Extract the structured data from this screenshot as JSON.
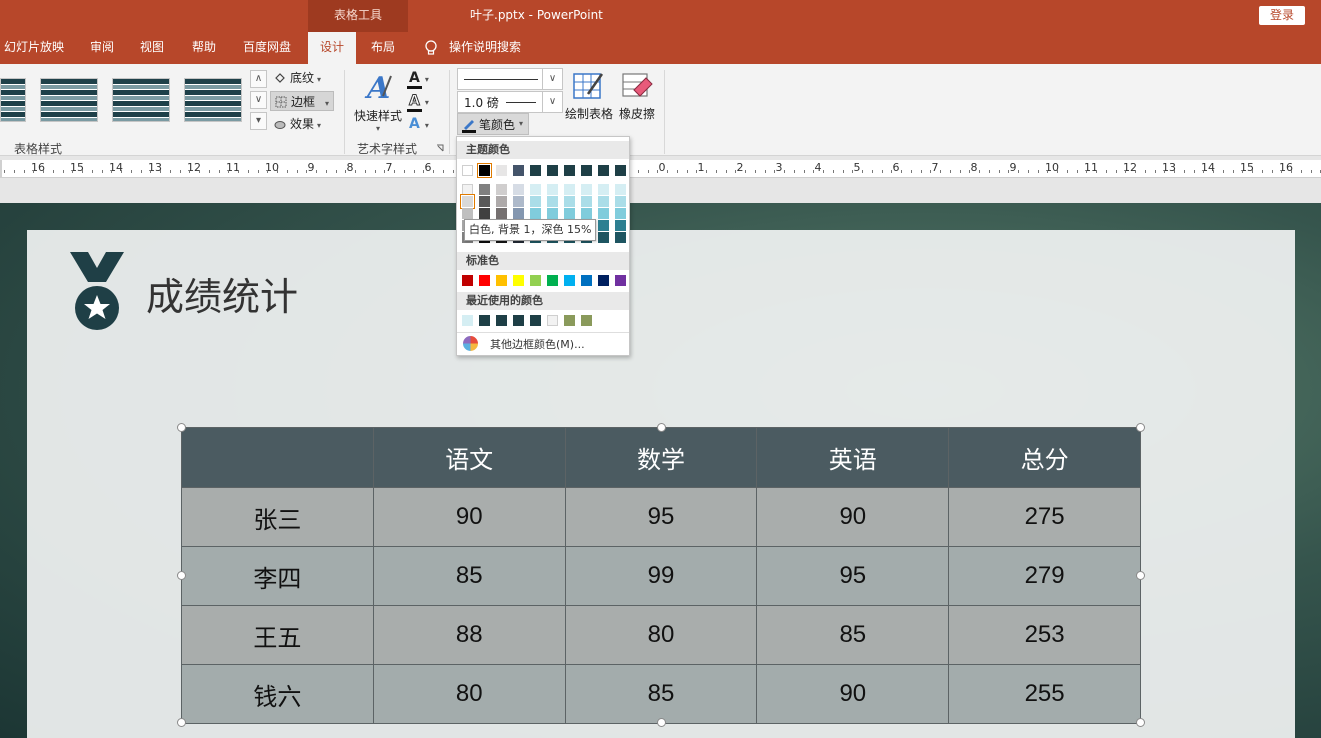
{
  "titlebar": {
    "context_tab": "表格工具",
    "window_title": "叶子.pptx  -  PowerPoint",
    "login_label": "登录"
  },
  "tabs": [
    {
      "label": "幻灯片放映",
      "active": false
    },
    {
      "label": "审阅",
      "active": false
    },
    {
      "label": "视图",
      "active": false
    },
    {
      "label": "帮助",
      "active": false
    },
    {
      "label": "百度网盘",
      "active": false
    },
    {
      "label": "设计",
      "active": true
    },
    {
      "label": "布局",
      "active": false
    }
  ],
  "tell_me": "操作说明搜索",
  "ribbon": {
    "table_styles": {
      "label": "表格样式",
      "shading": "底纹",
      "border": "边框",
      "effects": "效果"
    },
    "wordart": {
      "label": "艺术字样式",
      "quick_styles": "快速样式"
    },
    "draw_borders": {
      "pen_weight": "1.0 磅",
      "pen_color": "笔颜色",
      "draw_table": "绘制表格",
      "eraser": "橡皮擦"
    }
  },
  "ruler": {
    "labels": [
      "16",
      "15",
      "14",
      "13",
      "12",
      "11",
      "10",
      "9",
      "8",
      "7",
      "6",
      "5",
      "4",
      "3",
      "2",
      "1",
      "0",
      "1",
      "2",
      "3",
      "4",
      "5",
      "6",
      "7",
      "8",
      "9",
      "10",
      "11",
      "12",
      "13",
      "14",
      "15",
      "16"
    ]
  },
  "color_picker": {
    "theme_heading": "主题颜色",
    "standard_heading": "标准色",
    "recent_heading": "最近使用的颜色",
    "more_colors": "其他边框颜色(M)...",
    "tooltip": "白色, 背景 1，深色 15%",
    "theme_top": [
      "#ffffff",
      "#000000",
      "#e7e6e6",
      "#44546a",
      "#1e3f46",
      "#1e3f46",
      "#1e3f46",
      "#1e3f46",
      "#1e3f46",
      "#1e3f46"
    ],
    "theme_columns": [
      [
        "#f2f2f2",
        "#d9d9d9",
        "#bfbfbf",
        "#a6a6a6",
        "#808080"
      ],
      [
        "#808080",
        "#595959",
        "#404040",
        "#262626",
        "#0d0d0d"
      ],
      [
        "#d0cece",
        "#aeaaaa",
        "#757070",
        "#3b3838",
        "#161616"
      ],
      [
        "#d6dce5",
        "#adb9ca",
        "#8497b0",
        "#333f50",
        "#222a35"
      ],
      [
        "#d5eef3",
        "#aadde8",
        "#80ccdc",
        "#2d7f91",
        "#1e5561"
      ],
      [
        "#d5eef3",
        "#aadde8",
        "#80ccdc",
        "#2d7f91",
        "#1e5561"
      ],
      [
        "#d5eef3",
        "#aadde8",
        "#80ccdc",
        "#2d7f91",
        "#1e5561"
      ],
      [
        "#d5eef3",
        "#aadde8",
        "#80ccdc",
        "#2d7f91",
        "#1e5561"
      ],
      [
        "#d5eef3",
        "#aadde8",
        "#80ccdc",
        "#2d7f91",
        "#1e5561"
      ],
      [
        "#d5eef3",
        "#aadde8",
        "#80ccdc",
        "#2d7f91",
        "#1e5561"
      ]
    ],
    "standard": [
      "#c00000",
      "#ff0000",
      "#ffc000",
      "#ffff00",
      "#92d050",
      "#00b050",
      "#00b0f0",
      "#0070c0",
      "#002060",
      "#7030a0"
    ],
    "recent": [
      "#d5eef3",
      "#1e3f46",
      "#1e3f46",
      "#1e3f46",
      "#1e3f46",
      "#f2f2f2",
      "#8a9a5b",
      "#8a9a5b"
    ]
  },
  "slide": {
    "title": "成绩统计",
    "table": {
      "headers": [
        "",
        "语文",
        "数学",
        "英语",
        "总分"
      ],
      "rows": [
        [
          "张三",
          "90",
          "95",
          "90",
          "275"
        ],
        [
          "李四",
          "85",
          "99",
          "95",
          "279"
        ],
        [
          "王五",
          "88",
          "80",
          "85",
          "253"
        ],
        [
          "钱六",
          "80",
          "85",
          "90",
          "255"
        ]
      ]
    }
  }
}
